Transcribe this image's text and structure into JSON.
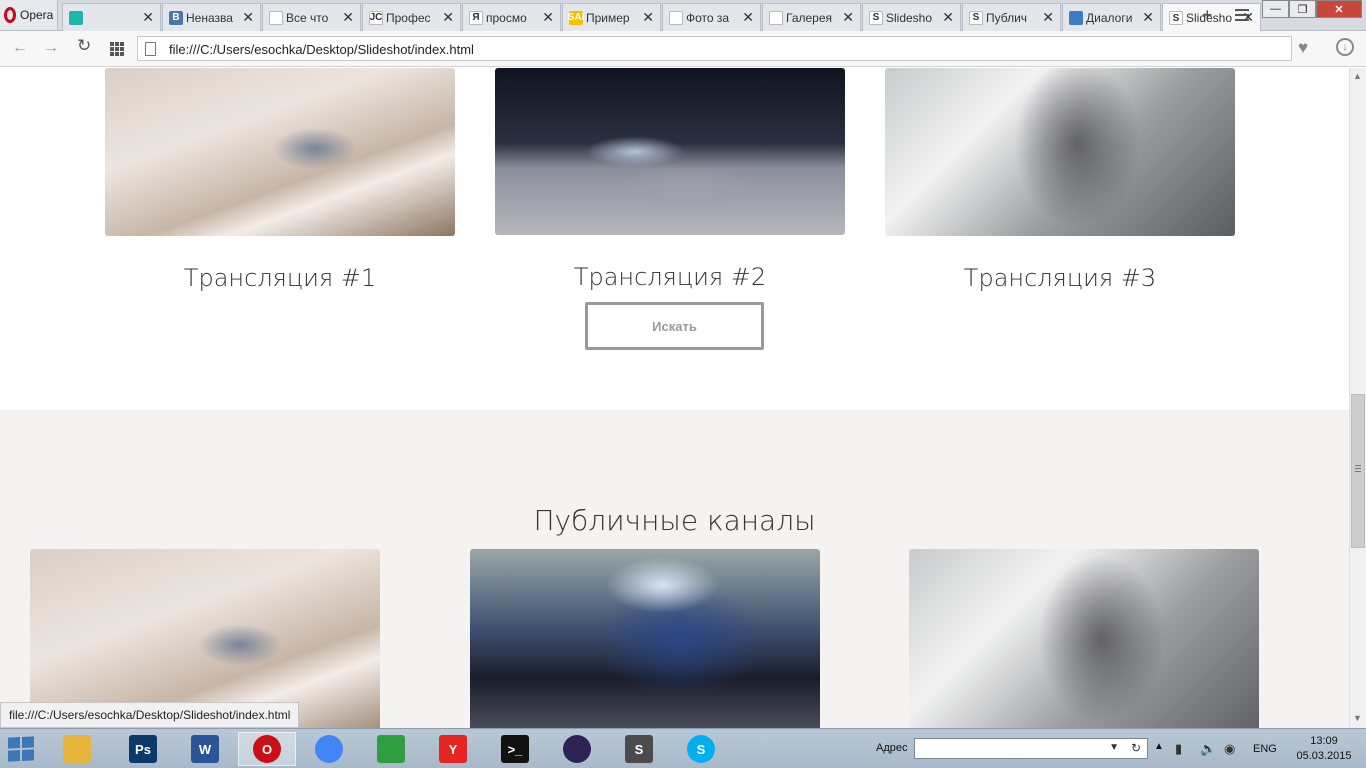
{
  "browser": {
    "menu_label": "Opera",
    "tabs": [
      {
        "title": "",
        "icon": "trello-icon",
        "color": "#1fb6b0",
        "glyph": ""
      },
      {
        "title": "Неназва",
        "icon": "vk-icon",
        "color": "#4a76a8",
        "glyph": "B"
      },
      {
        "title": "Все что",
        "icon": "bookmark-icon",
        "color": "#ffffff",
        "glyph": ""
      },
      {
        "title": "Профес",
        "icon": "jc-icon",
        "color": "#ffffff",
        "glyph": "JC"
      },
      {
        "title": "просмо",
        "icon": "yandex-icon",
        "color": "#ffffff",
        "glyph": "Я"
      },
      {
        "title": "Пример",
        "icon": "sai-icon",
        "color": "#f2c200",
        "glyph": "SAI"
      },
      {
        "title": "Фото за",
        "icon": "page-icon",
        "color": "#ffffff",
        "glyph": ""
      },
      {
        "title": "Галерея",
        "icon": "page-icon",
        "color": "#ffffff",
        "glyph": ""
      },
      {
        "title": "Slidesho",
        "icon": "slideshot-icon",
        "color": "#ffffff",
        "glyph": "S"
      },
      {
        "title": "Публич",
        "icon": "slideshot-icon",
        "color": "#ffffff",
        "glyph": "S"
      },
      {
        "title": "Диалоги",
        "icon": "chat-icon",
        "color": "#3d7cc4",
        "glyph": ""
      },
      {
        "title": "Slidesho",
        "icon": "slideshot-icon",
        "color": "#ffffff",
        "glyph": "S"
      }
    ],
    "new_tab_glyph": "+",
    "address": "file:///C:/Users/esochka/Desktop/Slideshot/index.html",
    "status_url": "file:///C:/Users/esochka/Desktop/Slideshot/index.html"
  },
  "page": {
    "broadcasts": [
      {
        "caption": "Трансляция #1",
        "image": "laptop-photo"
      },
      {
        "caption": "Трансляция #2",
        "image": "phone-photo"
      },
      {
        "caption": "Трансляция #3",
        "image": "plant-photo"
      }
    ],
    "search_button": "Искать",
    "public_title": "Публичные каналы",
    "public_channels": [
      {
        "image": "laptop-photo"
      },
      {
        "image": "phone-photo"
      },
      {
        "image": "plant-photo"
      }
    ]
  },
  "taskbar": {
    "apps": [
      {
        "name": "explorer",
        "icon": "folder-icon",
        "color": "#e7b53c",
        "glyph": ""
      },
      {
        "name": "photoshop",
        "icon": "photoshop-icon",
        "color": "#0b3a6a",
        "glyph": "Ps"
      },
      {
        "name": "word",
        "icon": "word-icon",
        "color": "#2a5699",
        "glyph": "W"
      },
      {
        "name": "opera",
        "icon": "opera-icon",
        "color": "#cc0f16",
        "glyph": "O"
      },
      {
        "name": "chrome",
        "icon": "chrome-icon",
        "color": "#4285f4",
        "glyph": ""
      },
      {
        "name": "store",
        "icon": "store-icon",
        "color": "#2f9e3e",
        "glyph": ""
      },
      {
        "name": "yandex",
        "icon": "yandex-browser-icon",
        "color": "#e52620",
        "glyph": "Y"
      },
      {
        "name": "cmd",
        "icon": "terminal-icon",
        "color": "#111111",
        "glyph": ">_"
      },
      {
        "name": "eclipse",
        "icon": "eclipse-icon",
        "color": "#2c2255",
        "glyph": ""
      },
      {
        "name": "sublime",
        "icon": "sublime-icon",
        "color": "#4b4b4b",
        "glyph": "S"
      },
      {
        "name": "skype",
        "icon": "skype-icon",
        "color": "#00aff0",
        "glyph": "S"
      }
    ],
    "address_label": "Адрес",
    "address_value": "",
    "language": "ENG",
    "time": "13:09",
    "date": "05.03.2015"
  }
}
